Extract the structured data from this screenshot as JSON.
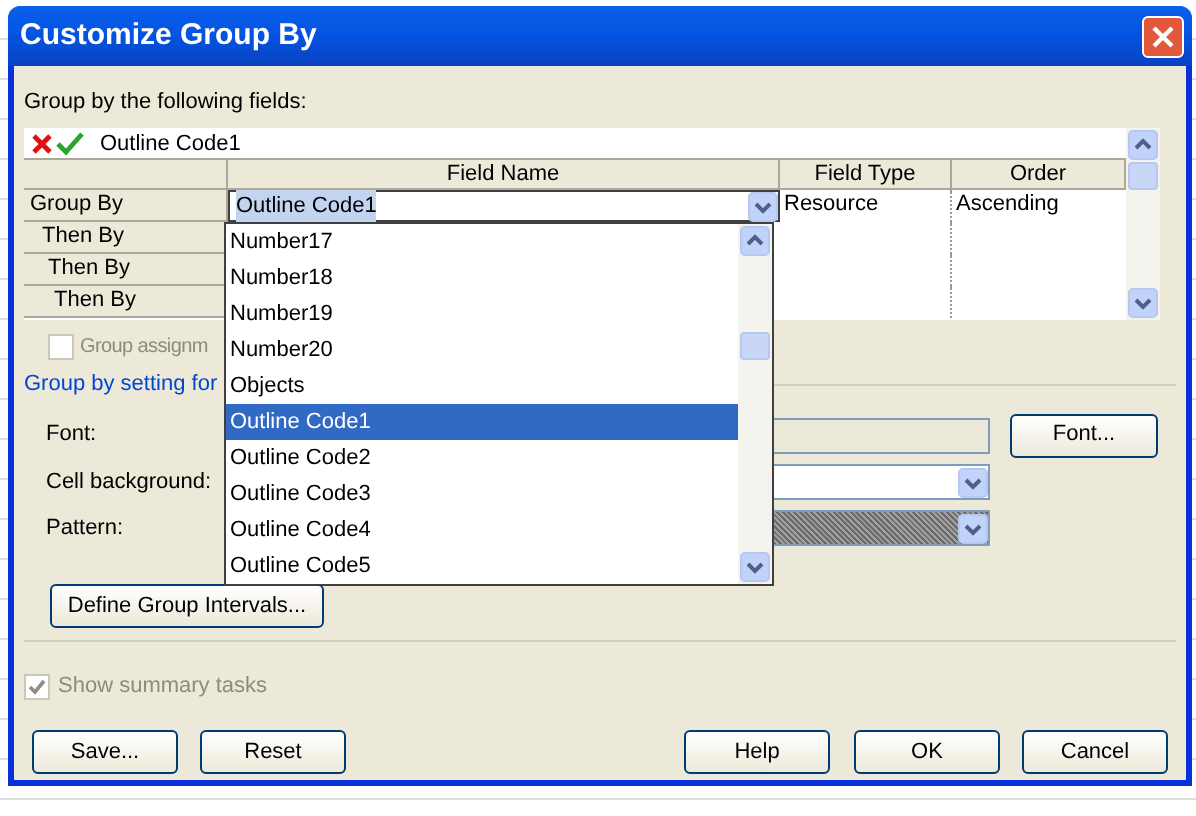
{
  "window": {
    "title": "Customize Group By"
  },
  "fields_label": "Group by the following fields:",
  "edit_bar": {
    "value": "Outline Code1"
  },
  "grid": {
    "columns": [
      "Field Name",
      "Field Type",
      "Order"
    ],
    "rows": [
      {
        "label": "Group By",
        "field_name": "Outline Code1",
        "field_type": "Resource",
        "order": "Ascending",
        "selected": true
      },
      {
        "label": "Then By",
        "selected": false
      },
      {
        "label": "Then By",
        "selected": false
      },
      {
        "label": "Then By",
        "selected": false
      }
    ]
  },
  "field_dropdown": {
    "items": [
      {
        "label": "Number17",
        "selected": false
      },
      {
        "label": "Number18",
        "selected": false
      },
      {
        "label": "Number19",
        "selected": false
      },
      {
        "label": "Number20",
        "selected": false
      },
      {
        "label": "Objects",
        "selected": false
      },
      {
        "label": "Outline Code1",
        "selected": true
      },
      {
        "label": "Outline Code2",
        "selected": false
      },
      {
        "label": "Outline Code3",
        "selected": false
      },
      {
        "label": "Outline Code4",
        "selected": false
      },
      {
        "label": "Outline Code5",
        "selected": false
      }
    ]
  },
  "group_assignments": {
    "label": "Group assignm",
    "checked": false,
    "disabled": true
  },
  "settings_label": "Group by setting for",
  "font": {
    "label": "Font:",
    "button": "Font..."
  },
  "cell_background": {
    "label": "Cell background:"
  },
  "pattern": {
    "label": "Pattern:"
  },
  "define_intervals_button": "Define Group Intervals...",
  "show_summary": {
    "label": "Show summary tasks",
    "checked": true,
    "disabled": true
  },
  "buttons": [
    "Save...",
    "Reset",
    "Help",
    "OK",
    "Cancel"
  ]
}
